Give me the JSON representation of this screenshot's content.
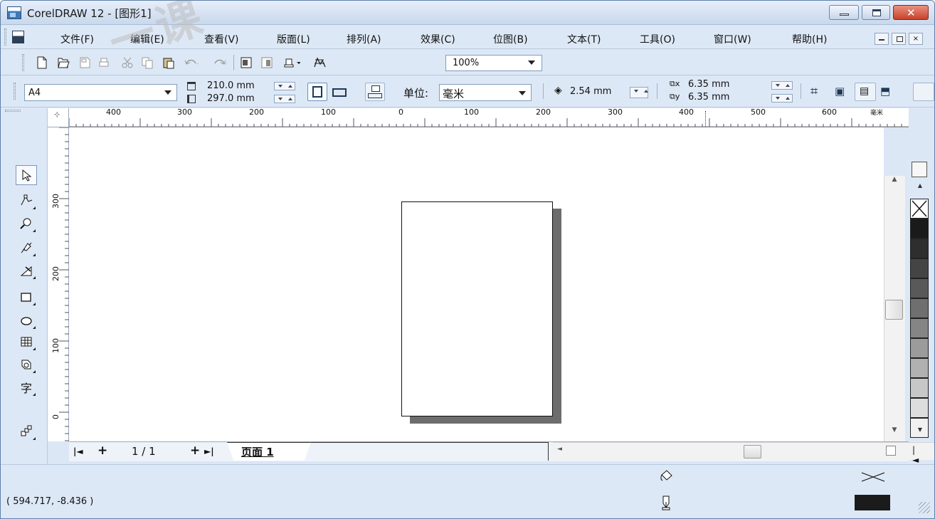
{
  "window": {
    "title": "CorelDRAW 12 - [图形1]"
  },
  "menu": {
    "items": [
      "文件(F)",
      "编辑(E)",
      "查看(V)",
      "版面(L)",
      "排列(A)",
      "效果(C)",
      "位图(B)",
      "文本(T)",
      "工具(O)",
      "窗口(W)",
      "帮助(H)"
    ]
  },
  "toolbar": {
    "zoom_value": "100%",
    "icons": [
      "new-icon",
      "open-icon",
      "save-icon",
      "print-icon",
      "cut-icon",
      "copy-icon",
      "paste-icon",
      "undo-icon",
      "redo-icon",
      "import-icon",
      "export-icon",
      "application-launcher-icon",
      "corel-online-icon"
    ]
  },
  "propbar": {
    "paper_size": "A4",
    "width": "210.0 mm",
    "height": "297.0 mm",
    "unit_label": "单位:",
    "unit_value": "毫米",
    "nudge": "2.54 mm",
    "dup_x": "6.35 mm",
    "dup_y": "6.35 mm",
    "x_sub": "x",
    "y_sub": "y"
  },
  "rulers": {
    "top_labels": [
      "400",
      "300",
      "200",
      "100",
      "0",
      "100",
      "200",
      "300",
      "400",
      "500",
      "600"
    ],
    "left_labels": [
      "300",
      "200",
      "100",
      "0"
    ],
    "unit": "毫米"
  },
  "pagenav": {
    "count": "1 / 1",
    "tab_label": "页面 1",
    "first_glyph": "|◄",
    "add_before": "+",
    "add_after": "+",
    "last_glyph": "►|"
  },
  "status": {
    "coordinates": "( 594.717, -8.436 )"
  },
  "palette": {
    "colors": [
      "#1a1a1a",
      "#2e2e2e",
      "#444444",
      "#595959",
      "#6f6f6f",
      "#858585",
      "#9b9b9b",
      "#b1b1b1",
      "#c7c7c7",
      "#dddddd",
      "#f1f1f1"
    ]
  },
  "watermark": {
    "text": "一课"
  }
}
